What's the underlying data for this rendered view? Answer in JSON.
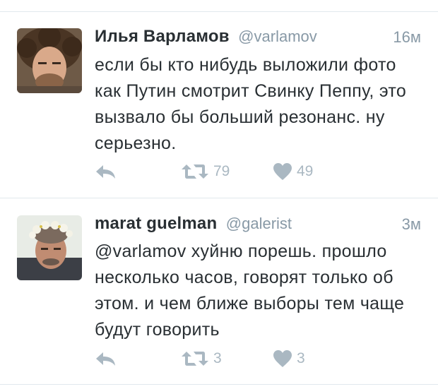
{
  "tweets": [
    {
      "name": "Илья Варламов",
      "handle": "@varlamov",
      "time": "16м",
      "text": "если бы кто нибудь выложили фото как Путин смотрит Свинку Пеппу, это вызвало бы больший резонанс. ну серьезно.",
      "retweets": "79",
      "likes": "49"
    },
    {
      "name": "marat guelman",
      "handle": "@galerist",
      "time": "3м",
      "text": "@varlamov хуйню порешь. прошло несколько часов, говорят только об этом. и чем ближе выборы тем чаще будут говорить",
      "retweets": "3",
      "likes": "3"
    }
  ],
  "colors": {
    "text": "#292f33",
    "secondary": "#8899a6",
    "icon": "#aab8c2",
    "divider": "#e1e8ed"
  },
  "icons": {
    "reply": "reply-icon",
    "retweet": "retweet-icon",
    "like": "heart-icon"
  }
}
